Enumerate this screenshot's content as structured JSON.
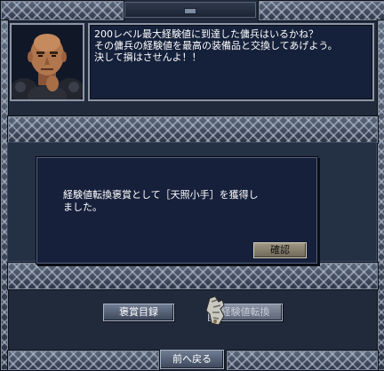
{
  "npc_speech": {
    "line1": "200レベル最大経験値に到達した傭兵はいるかね？",
    "line2": "その傭兵の経験値を最高の装備品と交換してあげよう。",
    "line3": "決して損はさせんよ！！"
  },
  "dialog": {
    "message_line1": "経験値転換褒賞として［天照小手］を獲得し",
    "message_line2": "ました。",
    "confirm_label": "確認"
  },
  "buttons": {
    "reward_list_label": "褒賞目録",
    "exp_exchange_label": "経験値転換",
    "back_label": "前へ戻る"
  },
  "icons": {
    "portrait": "bald-npc-portrait-icon",
    "item": "gauntlet-icon"
  },
  "colors": {
    "panel_bg": "#243044",
    "dialog_bg": "#16203b",
    "speech_bg": "#15203a",
    "confirm_button": "#a09884",
    "text": "#ffffff"
  }
}
